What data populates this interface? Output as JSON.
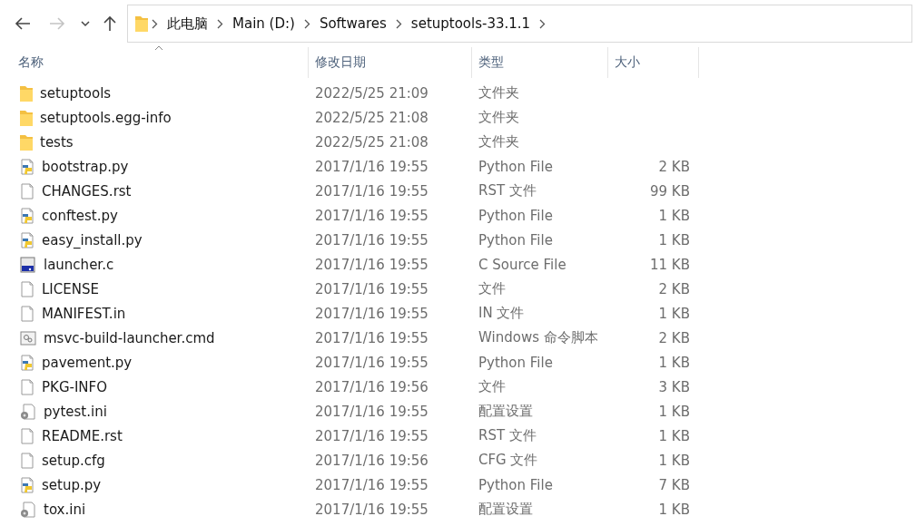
{
  "nav_buttons": [
    {
      "kind": "back",
      "disabled": false
    },
    {
      "kind": "forward",
      "disabled": true
    },
    {
      "kind": "recent",
      "disabled": false
    },
    {
      "kind": "up",
      "disabled": false
    }
  ],
  "breadcrumb": [
    "此电脑",
    "Main (D:)",
    "Softwares",
    "setuptools-33.1.1"
  ],
  "columns": [
    {
      "label": "名称",
      "sorted": true
    },
    {
      "label": "修改日期",
      "sorted": false
    },
    {
      "label": "类型",
      "sorted": false
    },
    {
      "label": "大小",
      "sorted": false
    }
  ],
  "rows": [
    {
      "kind": "folder",
      "name": "setuptools",
      "date": "2022/5/25 21:09",
      "type": "文件夹"
    },
    {
      "kind": "folder",
      "name": "setuptools.egg-info",
      "date": "2022/5/25 21:08",
      "type": "文件夹"
    },
    {
      "kind": "folder",
      "name": "tests",
      "date": "2022/5/25 21:08",
      "type": "文件夹"
    },
    {
      "kind": "python",
      "name": "bootstrap.py",
      "date": "2017/1/16 19:55",
      "type": "Python File",
      "size": "2 KB"
    },
    {
      "kind": "file",
      "name": "CHANGES.rst",
      "date": "2017/1/16 19:55",
      "type": "RST 文件",
      "size": "99 KB"
    },
    {
      "kind": "python",
      "name": "conftest.py",
      "date": "2017/1/16 19:55",
      "type": "Python File",
      "size": "1 KB"
    },
    {
      "kind": "python",
      "name": "easy_install.py",
      "date": "2017/1/16 19:55",
      "type": "Python File",
      "size": "1 KB"
    },
    {
      "kind": "csource",
      "name": "launcher.c",
      "date": "2017/1/16 19:55",
      "type": "C Source File",
      "size": "11 KB"
    },
    {
      "kind": "file",
      "name": "LICENSE",
      "date": "2017/1/16 19:55",
      "type": "文件",
      "size": "2 KB"
    },
    {
      "kind": "file",
      "name": "MANIFEST.in",
      "date": "2017/1/16 19:55",
      "type": "IN 文件",
      "size": "1 KB"
    },
    {
      "kind": "script",
      "name": "msvc-build-launcher.cmd",
      "date": "2017/1/16 19:55",
      "type": "Windows 命令脚本",
      "size": "2 KB"
    },
    {
      "kind": "python",
      "name": "pavement.py",
      "date": "2017/1/16 19:55",
      "type": "Python File",
      "size": "1 KB"
    },
    {
      "kind": "file",
      "name": "PKG-INFO",
      "date": "2017/1/16 19:56",
      "type": "文件",
      "size": "3 KB"
    },
    {
      "kind": "config",
      "name": "pytest.ini",
      "date": "2017/1/16 19:55",
      "type": "配置设置",
      "size": "1 KB"
    },
    {
      "kind": "file",
      "name": "README.rst",
      "date": "2017/1/16 19:55",
      "type": "RST 文件",
      "size": "1 KB"
    },
    {
      "kind": "file",
      "name": "setup.cfg",
      "date": "2017/1/16 19:56",
      "type": "CFG 文件",
      "size": "1 KB"
    },
    {
      "kind": "python",
      "name": "setup.py",
      "date": "2017/1/16 19:55",
      "type": "Python File",
      "size": "7 KB"
    },
    {
      "kind": "config",
      "name": "tox.ini",
      "date": "2017/1/16 19:55",
      "type": "配置设置",
      "size": "1 KB"
    }
  ]
}
